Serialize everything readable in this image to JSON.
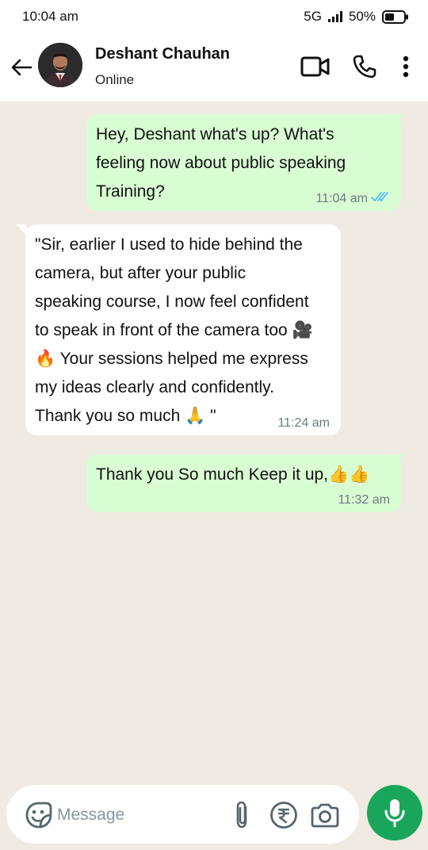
{
  "status_bar": {
    "time": "10:04 am",
    "network": "5G",
    "battery": "50%"
  },
  "header": {
    "contact_name": "Deshant Chauhan",
    "contact_status": "Online"
  },
  "messages": [
    {
      "direction": "outgoing",
      "text": "Hey, Deshant what's up? What's\nfeeling now about public speaking\nTraining?",
      "time": "11:04 am",
      "read": true
    },
    {
      "direction": "incoming",
      "text": "\"Sir, earlier I used to hide behind the\ncamera, but after your public\nspeaking course, I now feel confident\nto speak in front of the camera too 🎥\n🔥 Your sessions helped me express\nmy ideas clearly and confidently.\nThank you so much 🙏 \"",
      "time": "11:24 am"
    },
    {
      "direction": "outgoing",
      "text": "Thank you So much Keep it up,👍👍",
      "time": "11:32 am"
    }
  ],
  "composer": {
    "placeholder": "Message"
  },
  "colors": {
    "outgoing_bubble": "#d9fdd3",
    "incoming_bubble": "#ffffff",
    "chat_background": "#efeae2",
    "accent": "#1aa65a",
    "read_ticks": "#53bdeb"
  }
}
